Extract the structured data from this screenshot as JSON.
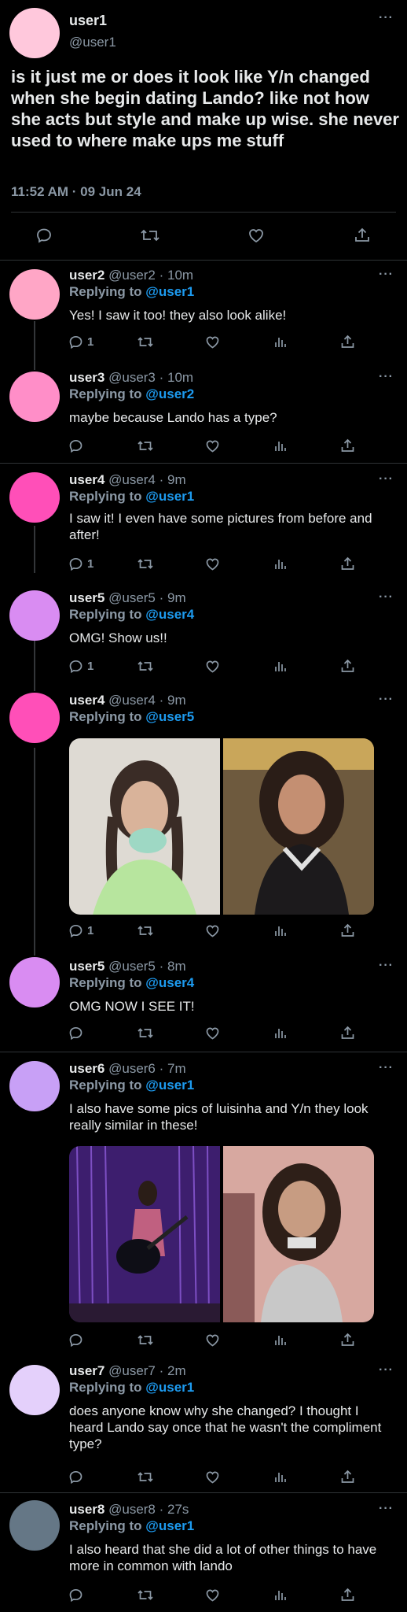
{
  "main": {
    "name": "user1",
    "handle": "@user1",
    "text": "is it just me or does it look like Y/n changed when she begin dating Lando? like not how she acts but style and make up wise. she never used to where make ups me stuff",
    "timestamp": "11:52 AM · 09 Jun 24",
    "more": "···"
  },
  "replies": [
    {
      "name": "user2",
      "meta": "@user2 · 10m",
      "replying_prefix": "Replying to ",
      "mention": "@user1",
      "text": "Yes! I saw it too! they also look alike!",
      "reply_count": "1",
      "more": "···"
    },
    {
      "name": "user3",
      "meta": "@user3 · 10m",
      "replying_prefix": "Replying to ",
      "mention": "@user2",
      "text": "maybe because Lando has a type?",
      "reply_count": "",
      "more": "···"
    },
    {
      "name": "user4",
      "meta": "@user4 · 9m",
      "replying_prefix": "Replying to ",
      "mention": "@user1",
      "text": "I saw it! I even have some pictures from before and after!",
      "reply_count": "1",
      "more": "···"
    },
    {
      "name": "user5",
      "meta": "@user5 · 9m",
      "replying_prefix": "Replying to ",
      "mention": "@user4",
      "text": "OMG! Show us!!",
      "reply_count": "1",
      "more": "···"
    },
    {
      "name": "user4",
      "meta": "@user4 · 9m",
      "replying_prefix": "Replying to ",
      "mention": "@user5",
      "text": "",
      "reply_count": "1",
      "more": "···"
    },
    {
      "name": "user5",
      "meta": "@user5 · 8m",
      "replying_prefix": "Replying to ",
      "mention": "@user4",
      "text": "OMG NOW I SEE IT!",
      "reply_count": "",
      "more": "···"
    },
    {
      "name": "user6",
      "meta": "@user6 · 7m",
      "replying_prefix": "Replying to ",
      "mention": "@user1",
      "text": "I also have some pics of luisinha and Y/n they look really similar in these!",
      "reply_count": "",
      "more": "···"
    },
    {
      "name": "user7",
      "meta": "@user7 · 2m",
      "replying_prefix": "Replying to ",
      "mention": "@user1",
      "text": "does anyone know why she changed? I thought I heard Lando say once that he wasn't the compliment type?",
      "reply_count": "",
      "more": "···"
    },
    {
      "name": "user8",
      "meta": "@user8 · 27s",
      "replying_prefix": "Replying to ",
      "mention": "@user1",
      "text": "I also heard that she did a lot of other things to have more in common with lando",
      "reply_count": "",
      "more": "···"
    }
  ],
  "colors": {
    "background": "#000000",
    "text": "#e7e9ea",
    "secondary": "#8b98a5",
    "accent": "#1d9bf0",
    "divider": "#2f3336",
    "avatar_user1": "#ffc8dc",
    "avatar_user2": "#ffa6c6",
    "avatar_user3": "#ff8ec8",
    "avatar_user4": "#ff4fb8",
    "avatar_user5": "#d98cf2",
    "avatar_user6": "#c8a0f6",
    "avatar_user7": "#e4d0fb",
    "avatar_user8": "#657786"
  },
  "icons": [
    "comment-icon",
    "retweet-icon",
    "like-icon",
    "analytics-icon",
    "share-icon",
    "more-icon"
  ]
}
